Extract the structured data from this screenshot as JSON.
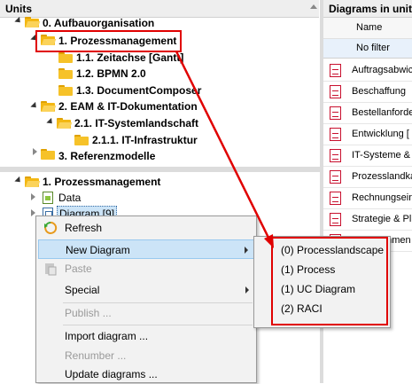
{
  "units_panel": {
    "title": "Units",
    "tree": [
      {
        "label": "0. Aufbauorganisation"
      },
      {
        "label": "1. Prozessmanagement"
      },
      {
        "label": "1.1. Zeitachse [Gantt]"
      },
      {
        "label": "1.2. BPMN 2.0"
      },
      {
        "label": "1.3. DocumentComposer"
      },
      {
        "label": "2. EAM & IT-Dokumentation"
      },
      {
        "label": "2.1. IT-Systemlandschaft"
      },
      {
        "label": "2.1.1. IT-Infrastruktur"
      },
      {
        "label": "3. Referenzmodelle"
      }
    ]
  },
  "lower_tree": {
    "root": "1. Prozessmanagement",
    "items": [
      "Data",
      "Diagram [9]"
    ]
  },
  "diagrams_panel": {
    "title": "Diagrams in unit",
    "column_header": "Name",
    "filter_text": "No filter",
    "rows": [
      "Auftragsabwicklung",
      "Beschaffung",
      "Bestellanforderung",
      "Entwicklung [",
      "IT-Systeme &",
      "Prozesslandkarte",
      "Rechnungseingang",
      "Strategie & Pl",
      "Unternehmen"
    ]
  },
  "context_menu": {
    "items": [
      {
        "label": "Refresh",
        "disabled": false,
        "submenu": false
      },
      {
        "label": "New Diagram",
        "disabled": false,
        "submenu": true,
        "highlighted": true
      },
      {
        "label": "Paste",
        "disabled": true,
        "submenu": false
      },
      {
        "label": "Special",
        "disabled": false,
        "submenu": true
      },
      {
        "label": "Publish ...",
        "disabled": true,
        "submenu": false
      },
      {
        "label": "Import diagram ...",
        "disabled": false,
        "submenu": false
      },
      {
        "label": "Renumber ...",
        "disabled": true,
        "submenu": false
      },
      {
        "label": "Update diagrams ...",
        "disabled": false,
        "submenu": false
      }
    ]
  },
  "submenu": {
    "items": [
      "(0) Processlandscape",
      "(1) Process",
      "(1) UC Diagram",
      "(2) RACI"
    ]
  },
  "colors": {
    "highlight": "#e00000",
    "menu_hover": "#cce4f7",
    "folder": "#f6c229"
  }
}
